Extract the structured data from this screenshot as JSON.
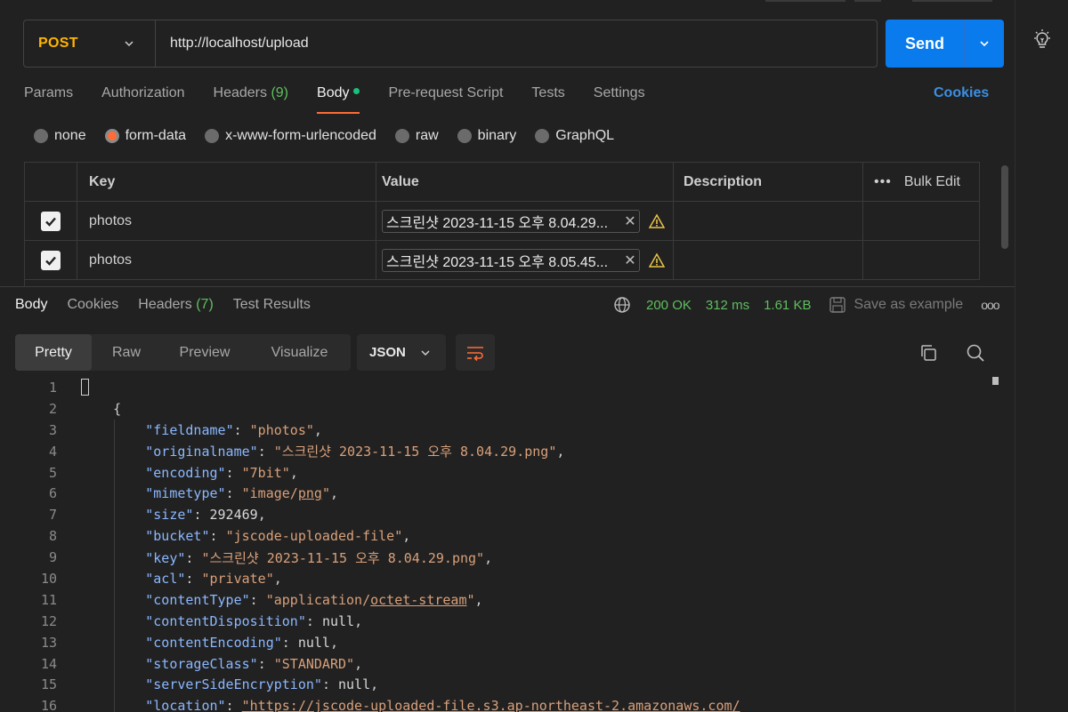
{
  "request": {
    "method": "POST",
    "url": "http://localhost/upload",
    "send_label": "Send"
  },
  "request_tabs": [
    {
      "label": "Params"
    },
    {
      "label": "Authorization"
    },
    {
      "label": "Headers",
      "count": "(9)"
    },
    {
      "label": "Body"
    },
    {
      "label": "Pre-request Script"
    },
    {
      "label": "Tests"
    },
    {
      "label": "Settings"
    }
  ],
  "cookies_label": "Cookies",
  "body_types": [
    "none",
    "form-data",
    "x-www-form-urlencoded",
    "raw",
    "binary",
    "GraphQL"
  ],
  "form_table": {
    "headers": {
      "key": "Key",
      "value": "Value",
      "description": "Description",
      "bulk_edit": "Bulk Edit"
    },
    "rows": [
      {
        "key": "photos",
        "value": "스크린샷 2023-11-15 오후 8.04.29..."
      },
      {
        "key": "photos",
        "value": "스크린샷 2023-11-15 오후 8.05.45..."
      }
    ]
  },
  "response_tabs": [
    {
      "label": "Body"
    },
    {
      "label": "Cookies"
    },
    {
      "label": "Headers",
      "count": "(7)"
    },
    {
      "label": "Test Results"
    }
  ],
  "response_meta": {
    "status": "200 OK",
    "time": "312 ms",
    "size": "1.61 KB",
    "save_label": "Save as example"
  },
  "view_modes": [
    "Pretty",
    "Raw",
    "Preview",
    "Visualize"
  ],
  "format": "JSON",
  "code_lines": [
    {
      "n": "1"
    },
    {
      "n": "2",
      "text": "{"
    },
    {
      "n": "3",
      "k": "fieldname",
      "v": "\"photos\""
    },
    {
      "n": "4",
      "k": "originalname",
      "v": "\"스크린샷 2023-11-15 오후 8.04.29.png\""
    },
    {
      "n": "5",
      "k": "encoding",
      "v": "\"7bit\""
    },
    {
      "n": "6",
      "k": "mimetype",
      "v": "\"image/png\""
    },
    {
      "n": "7",
      "k": "size",
      "num": "292469"
    },
    {
      "n": "8",
      "k": "bucket",
      "v": "\"jscode-uploaded-file\""
    },
    {
      "n": "9",
      "k": "key",
      "v": "\"스크린샷 2023-11-15 오후 8.04.29.png\""
    },
    {
      "n": "10",
      "k": "acl",
      "v": "\"private\""
    },
    {
      "n": "11",
      "k": "contentType",
      "v": "\"application/octet-stream\""
    },
    {
      "n": "12",
      "k": "contentDisposition",
      "num": "null"
    },
    {
      "n": "13",
      "k": "contentEncoding",
      "num": "null"
    },
    {
      "n": "14",
      "k": "storageClass",
      "v": "\"STANDARD\""
    },
    {
      "n": "15",
      "k": "serverSideEncryption",
      "num": "null"
    },
    {
      "n": "16",
      "k": "location",
      "v": "\"https://jscode-uploaded-file.s3.ap-northeast-2.amazonaws.com/"
    }
  ],
  "colors": {
    "accent": "#ff6c37",
    "send": "#097bed",
    "method": "#ffb400",
    "status": "#5fbf5f",
    "link": "#3d8fe3"
  }
}
